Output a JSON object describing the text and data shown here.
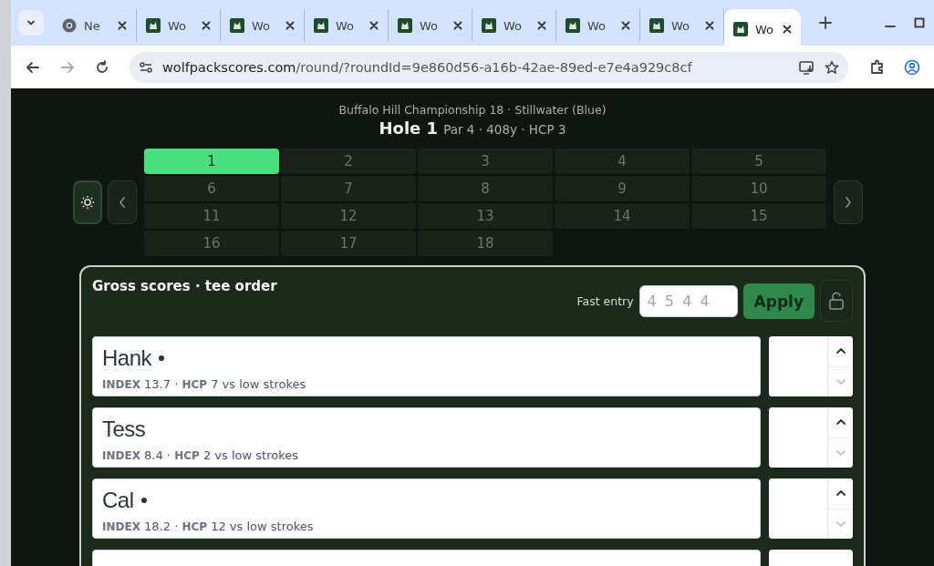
{
  "browser": {
    "tabs": [
      {
        "title": "Ne",
        "kind": "browser",
        "selected": false
      },
      {
        "title": "Wo",
        "kind": "site",
        "selected": false
      },
      {
        "title": "Wo",
        "kind": "site",
        "selected": false
      },
      {
        "title": "Wo",
        "kind": "site",
        "selected": false
      },
      {
        "title": "Wo",
        "kind": "site",
        "selected": false
      },
      {
        "title": "Wo",
        "kind": "site",
        "selected": false
      },
      {
        "title": "Wo",
        "kind": "site",
        "selected": false
      },
      {
        "title": "Wo",
        "kind": "site",
        "selected": false
      },
      {
        "title": "Wo",
        "kind": "site",
        "selected": true
      }
    ],
    "url_host": "wolfpackscores.com",
    "url_path": "/round/?roundId=9e860d56-a16b-42ae-89ed-e7e4a929c8cf"
  },
  "header": {
    "course": "Buffalo Hill Championship 18 · Stillwater (Blue)",
    "hole": "Hole 1",
    "details": "Par 4 · 408y · HCP 3"
  },
  "holes": [
    {
      "label": "1",
      "selected": true
    },
    {
      "label": "2",
      "selected": false
    },
    {
      "label": "3",
      "selected": false
    },
    {
      "label": "4",
      "selected": false
    },
    {
      "label": "5",
      "selected": false
    },
    {
      "label": "6",
      "selected": false
    },
    {
      "label": "7",
      "selected": false
    },
    {
      "label": "8",
      "selected": false
    },
    {
      "label": "9",
      "selected": false
    },
    {
      "label": "10",
      "selected": false
    },
    {
      "label": "11",
      "selected": false
    },
    {
      "label": "12",
      "selected": false
    },
    {
      "label": "13",
      "selected": false
    },
    {
      "label": "14",
      "selected": false
    },
    {
      "label": "15",
      "selected": false
    },
    {
      "label": "16",
      "selected": false
    },
    {
      "label": "17",
      "selected": false
    },
    {
      "label": "18",
      "selected": false
    }
  ],
  "scores": {
    "title": "Gross scores · tee order",
    "fast_entry_label": "Fast entry",
    "fast_entry_placeholder": "4 5 4 4",
    "apply": "Apply",
    "locked": false,
    "players": [
      {
        "name": "Hank",
        "stroke_dot": true,
        "meta": "**INDEX** 13.7 · **HCP** 7 vs low strokes",
        "down_disabled": true
      },
      {
        "name": "Tess",
        "stroke_dot": false,
        "meta": "**INDEX** 8.4 · **HCP** 2 vs low strokes",
        "down_disabled": true
      },
      {
        "name": "Cal",
        "stroke_dot": true,
        "meta": "**INDEX** 18.2 · **HCP** 12 vs low strokes",
        "down_disabled": true
      }
    ],
    "more_rows_below": true
  }
}
